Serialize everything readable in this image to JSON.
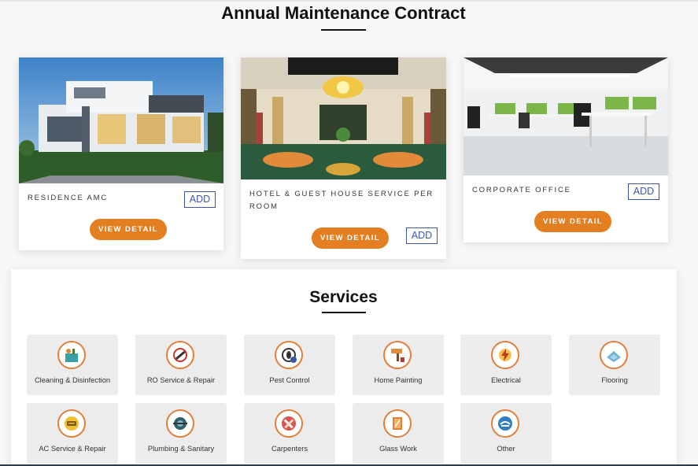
{
  "amc": {
    "title": "Annual Maintenance Contract",
    "cards": [
      {
        "label": "RESIDENCE AMC",
        "add": "ADD",
        "view": "VIEW DETAIL",
        "image": "modern-house-photo"
      },
      {
        "label": "HOTEL & GUEST HOUSE SERVICE PER ROOM",
        "add": "ADD",
        "view": "VIEW DETAIL",
        "image": "hotel-lobby-photo"
      },
      {
        "label": "CORPORATE OFFICE",
        "add": "ADD",
        "view": "VIEW DETAIL",
        "image": "office-interior-photo"
      }
    ]
  },
  "services": {
    "title": "Services",
    "items": [
      {
        "label": "Cleaning & Disinfection",
        "icon": "cleaning-icon"
      },
      {
        "label": "RO Service & Repair",
        "icon": "ro-repair-icon"
      },
      {
        "label": "Pest Control",
        "icon": "pest-control-icon"
      },
      {
        "label": "Home Painting",
        "icon": "paint-roller-icon"
      },
      {
        "label": "Electrical",
        "icon": "electrical-icon"
      },
      {
        "label": "Flooring",
        "icon": "flooring-icon"
      },
      {
        "label": "AC Service & Repair",
        "icon": "ac-icon"
      },
      {
        "label": "Plumbing & Sanitary",
        "icon": "plumbing-icon"
      },
      {
        "label": "Carpenters",
        "icon": "carpenter-icon"
      },
      {
        "label": "Glass Work",
        "icon": "glass-icon"
      },
      {
        "label": "Other",
        "icon": "other-icon"
      }
    ]
  },
  "colors": {
    "accent": "#e47f21",
    "add_border": "#3c56a6",
    "tile_bg": "#ececec"
  }
}
